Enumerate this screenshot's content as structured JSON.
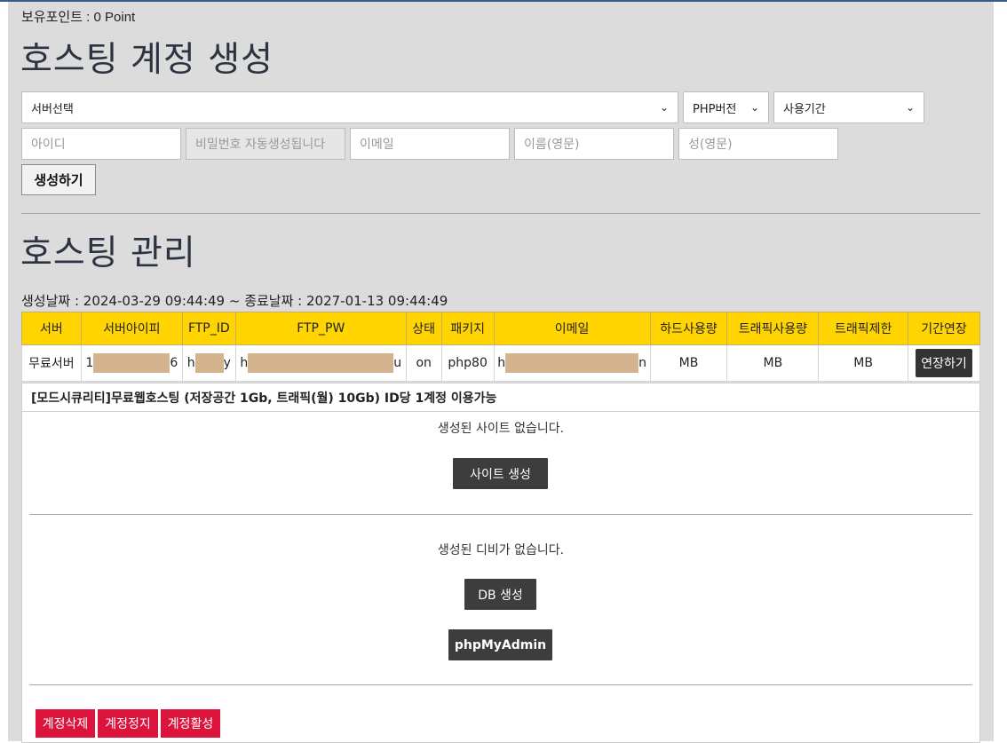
{
  "points_label": "보유포인트 : 0 Point",
  "create_section": {
    "title": "호스팅 계정 생성",
    "server_select": "서버선택",
    "php_select": "PHP버전",
    "period_select": "사용기간",
    "id_placeholder": "아이디",
    "password_placeholder": "비밀번호 자동생성됩니다",
    "email_placeholder": "이메일",
    "firstname_placeholder": "이름(영문)",
    "lastname_placeholder": "성(영문)",
    "create_button": "생성하기"
  },
  "manage_section": {
    "title": "호스팅 관리",
    "dates": "생성날짜 : 2024-03-29 09:44:49 ~ 종료날짜 : 2027-01-13 09:44:49",
    "table": {
      "headers": [
        "서버",
        "서버아이피",
        "FTP_ID",
        "FTP_PW",
        "상태",
        "패키지",
        "이메일",
        "하드사용량",
        "트래픽사용량",
        "트래픽제한",
        "기간연장"
      ],
      "row": {
        "server": "무료서버",
        "ip_start": "1",
        "ip_end": "6",
        "ftp_id_start": "h",
        "ftp_id_end": "y",
        "ftp_pw_start": "h",
        "ftp_pw_end": "u",
        "status": "on",
        "package": "php80",
        "email_start": "h",
        "email_end": "n",
        "disk": "MB",
        "traffic": "MB",
        "traffic_limit": "MB",
        "extend_button": "연장하기"
      }
    },
    "package_desc": "[모드시큐리티]무료웹호스팅 (저장공간 1Gb, 트래픽(월) 10Gb) ID당 1계정 이용가능",
    "no_site_msg": "생성된 사이트 없습니다.",
    "site_create_button": "사이트 생성",
    "no_db_msg": "생성된 디비가 없습니다.",
    "db_create_button": "DB 생성",
    "phpmyadmin_button": "phpMyAdmin",
    "delete_button": "계정삭제",
    "suspend_button": "계정정지",
    "activate_button": "계정활성"
  },
  "colors": {
    "header_yellow": "#ffd400",
    "danger_red": "#dc143c",
    "dark_button": "#3d3d3d",
    "panel_gray": "#dcdcdc",
    "redaction": "#d4b48f"
  }
}
